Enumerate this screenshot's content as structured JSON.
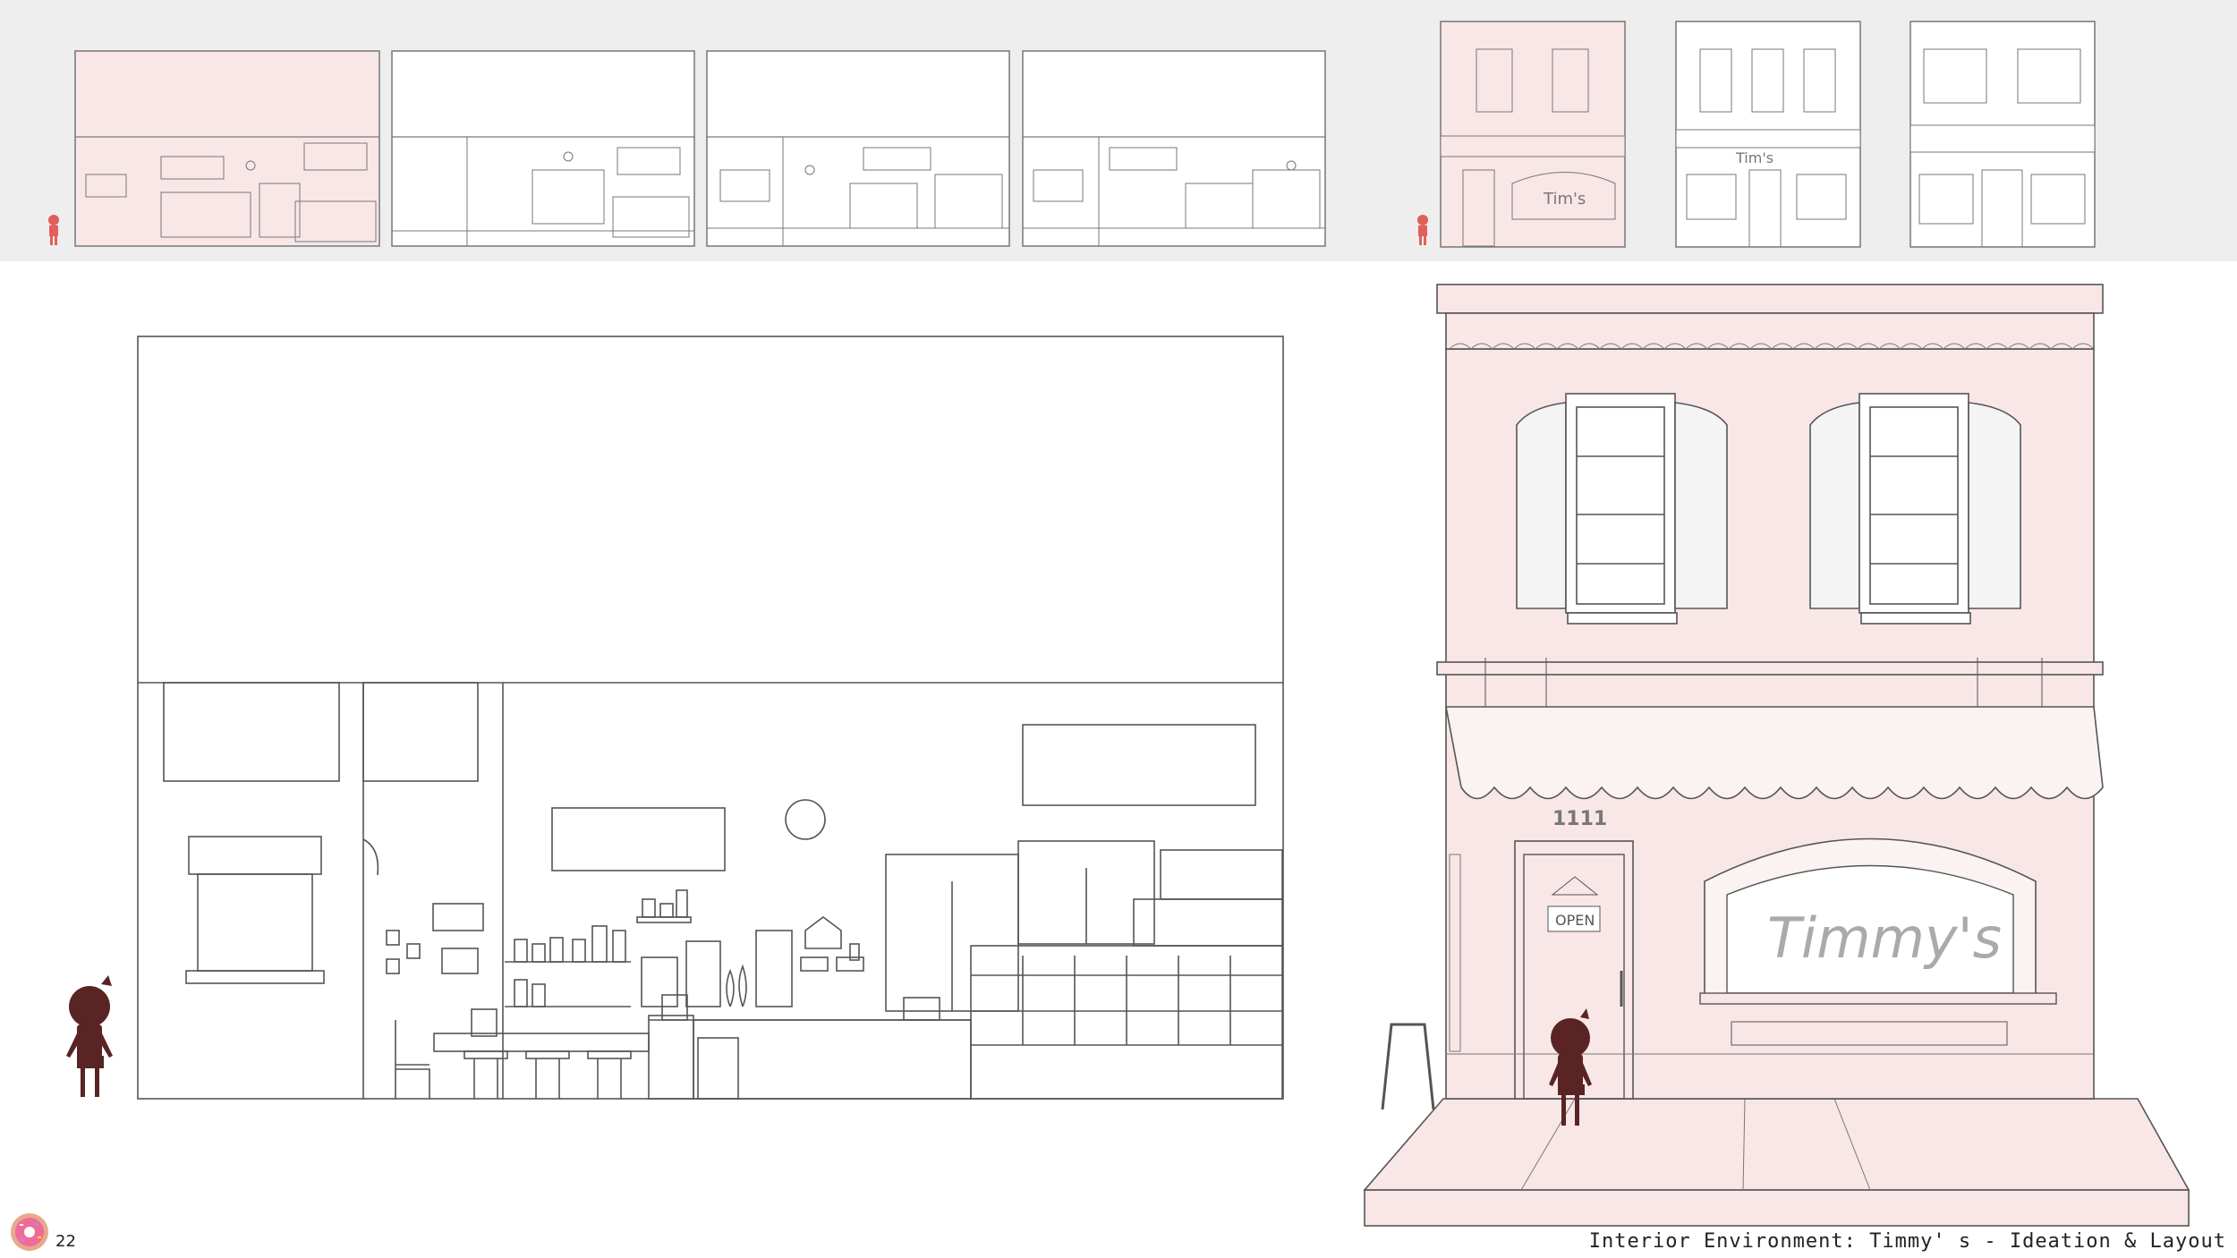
{
  "caption": "Interior Environment: Timmy' s - Ideation & Layout",
  "page_number": "22",
  "storefront": {
    "address_number": "1111",
    "door_sign": "OPEN",
    "window_sign": "Timmy's"
  },
  "thumbnails": {
    "exterior_sign": "Tim's"
  },
  "colors": {
    "accent_pink": "#f9e7e7",
    "line": "#555555",
    "character": "#5a2424",
    "thumb_character": "#e0605a"
  },
  "icons": {
    "logo": "donut-icon"
  }
}
